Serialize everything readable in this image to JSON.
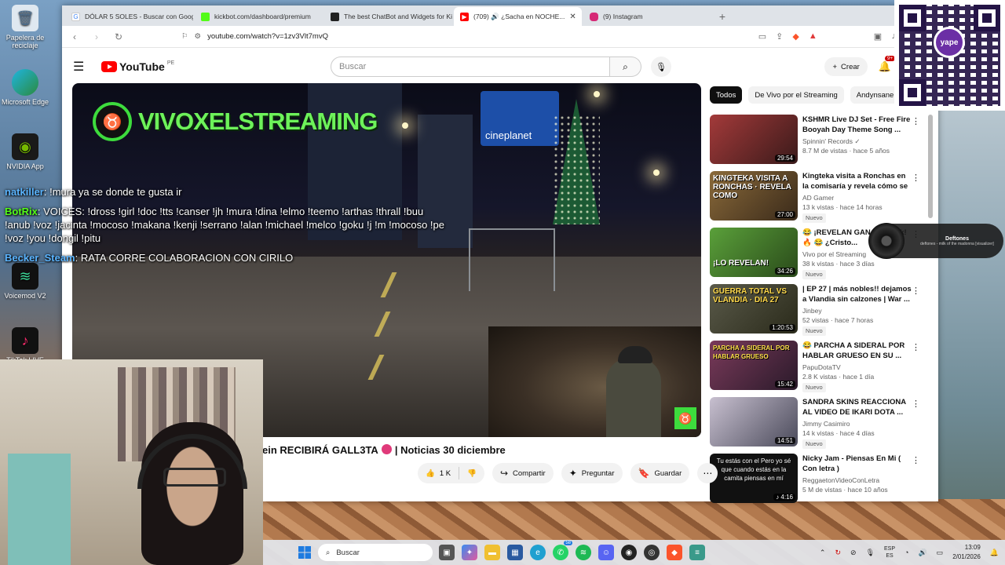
{
  "desktop": {
    "icons": [
      {
        "label": "Papelera de reciclaje",
        "icon": "recycle-bin-icon"
      },
      {
        "label": "Microsoft Edge",
        "icon": "edge-icon"
      },
      {
        "label": "NVIDIA App",
        "icon": "nvidia-icon"
      },
      {
        "label": "Voicemod V2",
        "icon": "voicemod-icon"
      },
      {
        "label": "TikTok LIVE",
        "icon": "tiktok-icon"
      }
    ]
  },
  "browser": {
    "tabs": [
      {
        "title": "DÓLAR 5 SOLES - Buscar con Google",
        "icon": "google-icon",
        "color": "#4285f4"
      },
      {
        "title": "kickbot.com/dashboard/premium",
        "icon": "kickbot-icon",
        "color": "#53fc18"
      },
      {
        "title": "The best ChatBot and Widgets for Ki...",
        "icon": "botrix-icon",
        "color": "#222222"
      },
      {
        "title": "(709) 🔊 ¿Sacha en NOCHE...",
        "icon": "youtube-icon",
        "color": "#ff0000",
        "active": true
      },
      {
        "title": "(9) Instagram",
        "icon": "instagram-icon",
        "color": "#d62976"
      }
    ],
    "url": "youtube.com/watch?v=1zv3Vlt7mvQ"
  },
  "youtube": {
    "logo": "YouTube",
    "country": "PE",
    "search_placeholder": "Buscar",
    "create_label": "Crear",
    "notifications": "9+",
    "video": {
      "brand": "VIVOXELSTREAMING",
      "storefront": "cineplanet",
      "title_visible": "ein RECIBIRÁ GALL3TA",
      "title_tail": "| Noticias 30 diciembre",
      "likes": "1 K",
      "share_label": "Compartir",
      "ask_label": "Preguntar",
      "save_label": "Guardar"
    },
    "chat": [
      {
        "user": "natkiller",
        "color": "#5ab4ff",
        "message": ": !mura ya se donde te gusta ir"
      },
      {
        "user": "BotRix",
        "color": "#53fc18",
        "message": ": VOICES: !dross !girl !doc !tts !canser !jh !mura !dina !elmo !teemo !arthas !thrall !buu !anub !voz !jacinta !mocoso !makana !kenji !serrano !alan !michael !melco !goku !j !m !mocoso !pe !voz !you !dongil !pitu"
      },
      {
        "user": "Becker_Steam",
        "color": "#5ab4ff",
        "message": ": RATA CORRE COLABORACION CON CIRILO"
      }
    ],
    "chips": [
      "Todos",
      "De Vivo por el Streaming",
      "Andynsane"
    ],
    "recommendations": [
      {
        "title": "KSHMR Live DJ Set - Free Fire Booyah Day Theme Song ...",
        "channel": "Spinnin' Records ✓",
        "meta": "8.7 M de vistas · hace 5 años",
        "duration": "29:54",
        "new": "",
        "thumb_text": "",
        "thumb_color": "#8e2a2a"
      },
      {
        "title": "Kingteka visita a Ronchas en la comisaría y revela cómo se ...",
        "channel": "AD Gamer",
        "meta": "13 k vistas · hace 14 horas",
        "duration": "27:00",
        "new": "Nuevo",
        "thumb_text": "KINGTEKA VISITA A RONCHAS · REVELA COMO",
        "thumb_color": "#6a4a2a"
      },
      {
        "title": "😂 ¡REVELAN GANAN... kick! 🔥 😂 ¿Cristo...",
        "channel": "Vivo por el Streaming",
        "meta": "38 k vistas · hace 3 días",
        "duration": "34:26",
        "new": "Nuevo",
        "thumb_text": "¡LO REVELAN!",
        "thumb_color": "#3f7a2a"
      },
      {
        "title": "| EP 27 | más nobles!! dejamos a Vlandia sin calzones | War ...",
        "channel": "Jinbey",
        "meta": "52 vistas · hace 7 horas",
        "duration": "1:20:53",
        "new": "Nuevo",
        "thumb_text": "GUERRA TOTAL VS VLANDIA · DIA 27",
        "thumb_color": "#4a4a3a"
      },
      {
        "title": "😂 PARCHA A SIDERAL POR HABLAR GRUESO EN SU ...",
        "channel": "PapuDotaTV",
        "meta": "2.8 K vistas · hace 1 día",
        "duration": "15:42",
        "new": "Nuevo",
        "thumb_text": "PARCHA A SIDERAL POR HABLAR GRUESO",
        "thumb_color": "#5a2a4a"
      },
      {
        "title": "SANDRA SKINS REACCIONA AL VIDEO DE IKARI DOTA ...",
        "channel": "Jimmy Casimiro",
        "meta": "14 k vistas · hace 4 días",
        "duration": "14:51",
        "new": "Nuevo",
        "thumb_text": "",
        "thumb_color": "#7a7a8a"
      },
      {
        "title": "Nicky Jam - Piensas En Mi ( Con letra )",
        "channel": "ReggaetonVideoConLetra",
        "meta": "5 M de vistas · hace 10 años",
        "duration": "♪ 4:16",
        "new": "",
        "thumb_text": "Tu estás con el Pero yo sé que cuando estás en la camita piensas en mí",
        "thumb_color": "#111111"
      }
    ]
  },
  "overlays": {
    "qr_brand": "yape",
    "music_title": "Deftones",
    "music_sub": "deftones - milk of the madonna [visualizer]"
  },
  "taskbar": {
    "search_placeholder": "Buscar",
    "whatsapp_badge": "58",
    "lang": "ESP",
    "lang_sub": "ES",
    "time": "13:09",
    "date": "2/01/2026"
  }
}
